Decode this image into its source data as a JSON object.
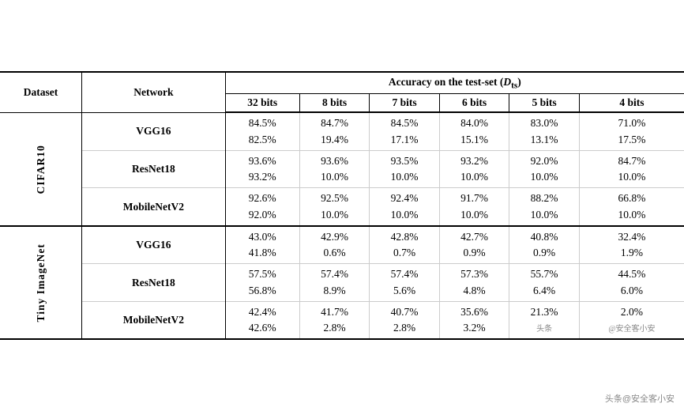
{
  "title": "Accuracy on test-set table",
  "header": {
    "dataset_label": "Dataset",
    "network_label": "Network",
    "accuracy_label": "Accuracy on the test-set",
    "accuracy_subscript": "(D_ts)",
    "bits": [
      "32 bits",
      "8 bits",
      "7 bits",
      "6 bits",
      "5 bits",
      "4 bits"
    ]
  },
  "sections": [
    {
      "dataset": "CIFAR10",
      "rows": [
        {
          "network": "VGG16",
          "values": [
            [
              "84.5%",
              "82.5%"
            ],
            [
              "84.7%",
              "19.4%"
            ],
            [
              "84.5%",
              "17.1%"
            ],
            [
              "84.0%",
              "15.1%"
            ],
            [
              "83.0%",
              "13.1%"
            ],
            [
              "71.0%",
              "17.5%"
            ]
          ]
        },
        {
          "network": "ResNet18",
          "values": [
            [
              "93.6%",
              "93.2%"
            ],
            [
              "93.6%",
              "10.0%"
            ],
            [
              "93.5%",
              "10.0%"
            ],
            [
              "93.2%",
              "10.0%"
            ],
            [
              "92.0%",
              "10.0%"
            ],
            [
              "84.7%",
              "10.0%"
            ]
          ]
        },
        {
          "network": "MobileNetV2",
          "values": [
            [
              "92.6%",
              "92.0%"
            ],
            [
              "92.5%",
              "10.0%"
            ],
            [
              "92.4%",
              "10.0%"
            ],
            [
              "91.7%",
              "10.0%"
            ],
            [
              "88.2%",
              "10.0%"
            ],
            [
              "66.8%",
              "10.0%"
            ]
          ]
        }
      ]
    },
    {
      "dataset": "Tiny ImageNet",
      "rows": [
        {
          "network": "VGG16",
          "values": [
            [
              "43.0%",
              "41.8%"
            ],
            [
              "42.9%",
              "0.6%"
            ],
            [
              "42.8%",
              "0.7%"
            ],
            [
              "42.7%",
              "0.9%"
            ],
            [
              "40.8%",
              "0.9%"
            ],
            [
              "32.4%",
              "1.9%"
            ]
          ]
        },
        {
          "network": "ResNet18",
          "values": [
            [
              "57.5%",
              "56.8%"
            ],
            [
              "57.4%",
              "8.9%"
            ],
            [
              "57.4%",
              "5.6%"
            ],
            [
              "57.3%",
              "4.8%"
            ],
            [
              "55.7%",
              "6.4%"
            ],
            [
              "44.5%",
              "6.0%"
            ]
          ]
        },
        {
          "network": "MobileNetV2",
          "values": [
            [
              "42.4%",
              "42.6%"
            ],
            [
              "41.7%",
              "2.8%"
            ],
            [
              "40.7%",
              "2.8%"
            ],
            [
              "35.6%",
              "3.2%"
            ],
            [
              "21.3%",
              "头条"
            ],
            [
              "2.0%",
              ""
            ]
          ]
        }
      ]
    }
  ],
  "watermark": "头条@安全客小安"
}
